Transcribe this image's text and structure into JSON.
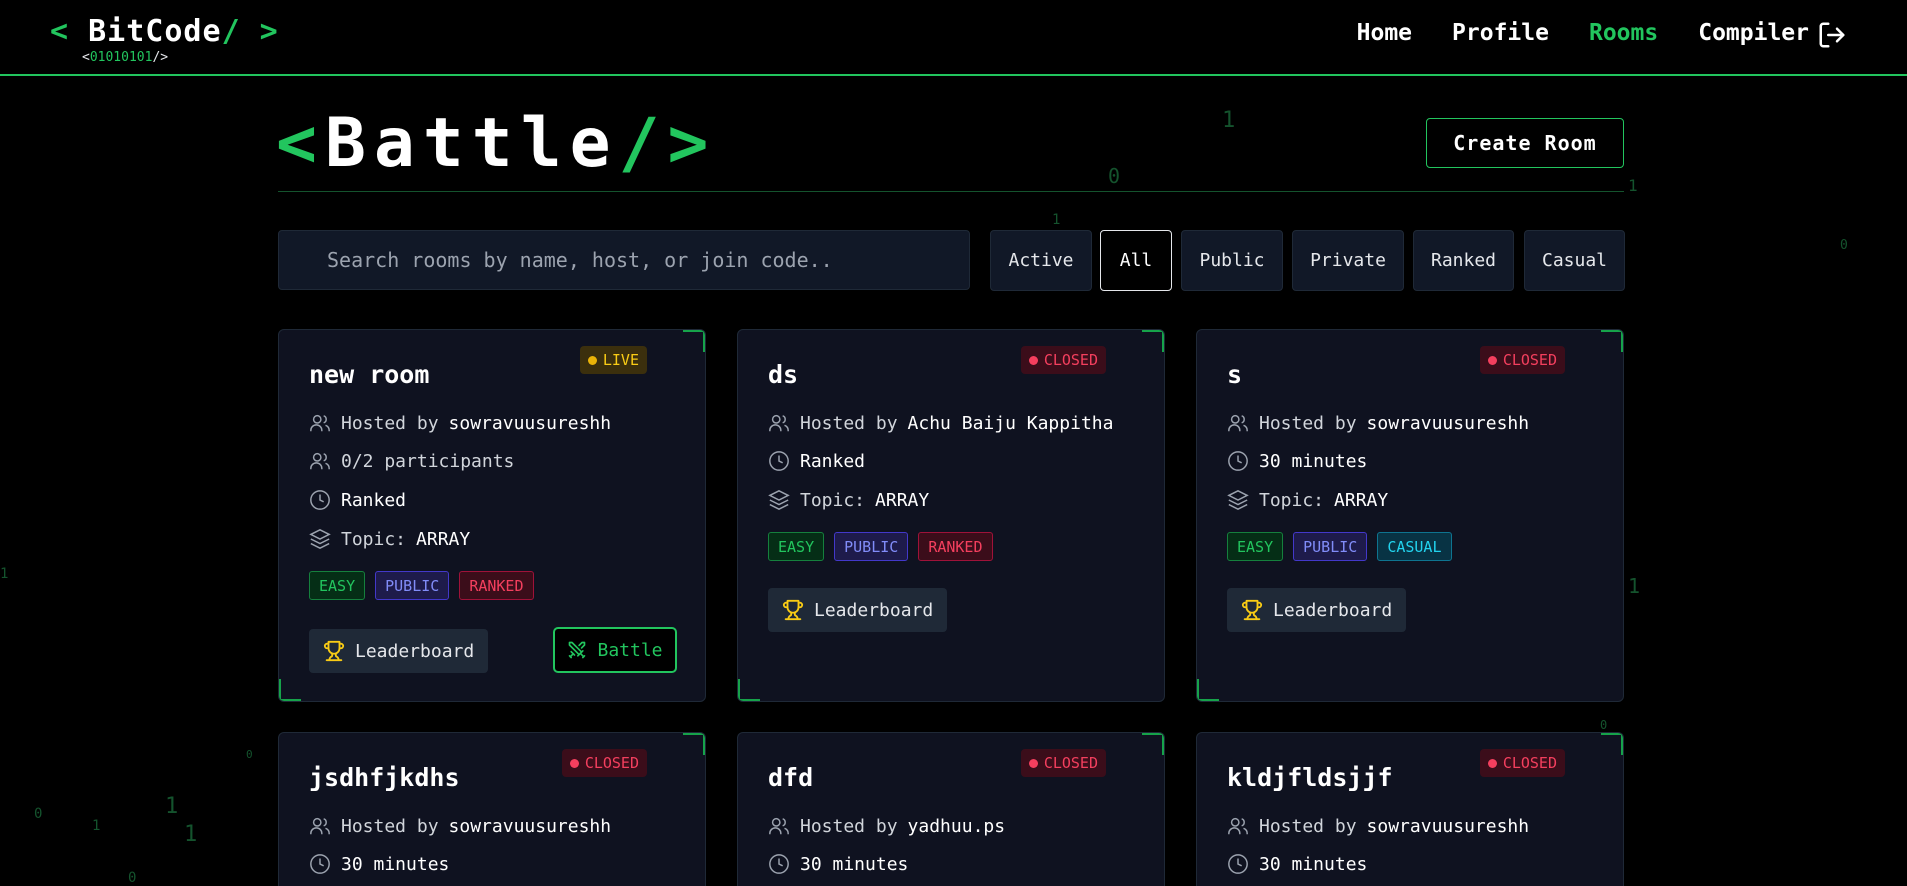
{
  "nav": {
    "logo_open": "< ",
    "logo_name": "BitCode",
    "logo_close": "/ >",
    "logo_sub_open": "<",
    "logo_sub_bits": "01010101",
    "logo_sub_close": "/>",
    "links": [
      {
        "label": "Home"
      },
      {
        "label": "Profile"
      },
      {
        "label": "Rooms"
      },
      {
        "label": "Compiler"
      }
    ],
    "active_link": "Rooms",
    "logout_icon": "logout-icon"
  },
  "header": {
    "title_open": "<",
    "title": "Battle",
    "title_close": "/>",
    "create_button": "Create Room"
  },
  "search": {
    "placeholder": "Search rooms by name, host, or join code.."
  },
  "filters": [
    {
      "label": "Active"
    },
    {
      "label": "All"
    },
    {
      "label": "Public"
    },
    {
      "label": "Private"
    },
    {
      "label": "Ranked"
    },
    {
      "label": "Casual"
    }
  ],
  "selected_filter": "All",
  "labels": {
    "hosted_by": "Hosted by",
    "topic": "Topic:",
    "leaderboard": "Leaderboard",
    "battle": "Battle"
  },
  "rooms": [
    {
      "name": "new room",
      "status": "LIVE",
      "host": "sowravuusureshh",
      "participants": "0/2 participants",
      "mode": "Ranked",
      "topic": "ARRAY",
      "tags": [
        "EASY",
        "PUBLIC",
        "RANKED"
      ]
    },
    {
      "name": "ds",
      "status": "CLOSED",
      "host": "Achu Baiju Kappitha",
      "mode": "Ranked",
      "topic": "ARRAY",
      "tags": [
        "EASY",
        "PUBLIC",
        "RANKED"
      ]
    },
    {
      "name": "s",
      "status": "CLOSED",
      "host": "sowravuusureshh",
      "duration": "30 minutes",
      "topic": "ARRAY",
      "tags": [
        "EASY",
        "PUBLIC",
        "CASUAL"
      ]
    },
    {
      "name": "jsdhfjkdhs",
      "status": "CLOSED",
      "host": "sowravuusureshh",
      "duration": "30 minutes"
    },
    {
      "name": "dfd",
      "status": "CLOSED",
      "host": "yadhuu.ps",
      "duration": "30 minutes"
    },
    {
      "name": "kldjfldsjjf",
      "status": "CLOSED",
      "host": "sowravuusureshh",
      "duration": "30 minutes"
    }
  ],
  "background_digits": [
    "1",
    "0",
    "1",
    "1",
    "0",
    "1",
    "1",
    "0",
    "1",
    "1",
    "0",
    "1",
    "0",
    "0"
  ],
  "colors": {
    "accent": "#22c55e",
    "background": "#000000",
    "card": "#0f1220",
    "live": "#eab308",
    "closed": "#f43f5e"
  }
}
